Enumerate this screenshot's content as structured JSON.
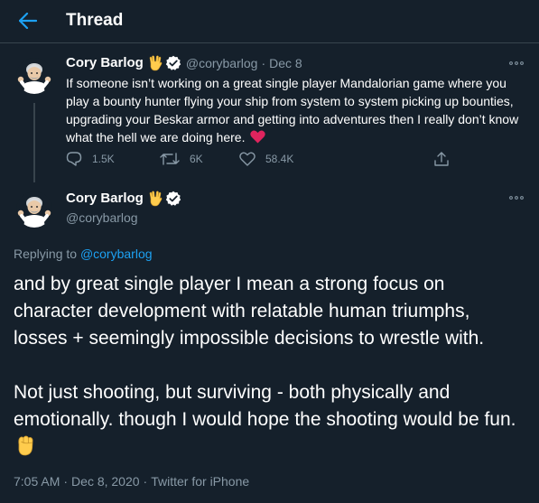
{
  "header": {
    "title": "Thread",
    "back_icon": "arrow-left-icon"
  },
  "colors": {
    "background": "#15202b",
    "accent": "#1da1f2",
    "muted": "#8899a6",
    "divider": "#38444d",
    "heart": "#e0245e"
  },
  "parent_tweet": {
    "display_name": "Cory Barlog",
    "handle": "@corybarlog",
    "separator": "·",
    "date": "Dec 8",
    "badges": [
      "vulcan-salute-emoji",
      "verified-badge-icon"
    ],
    "text": "If someone isn’t working on a great single player Mandalorian game where you play a bounty hunter flying your ship from system to system picking up bounties,  upgrading your Beskar armor and getting into adventures then I really don’t know what the hell we are doing here.",
    "text_emoji": "heart-emoji",
    "actions": {
      "replies": "1.5K",
      "retweets": "6K",
      "likes": "58.4K"
    }
  },
  "focal_tweet": {
    "display_name": "Cory Barlog",
    "handle": "@corybarlog",
    "replying_prefix": "Replying to ",
    "replying_to": "@corybarlog",
    "paragraph1": "and by great single player I mean a strong focus on character development with relatable human triumphs, losses + seemingly impossible decisions to wrestle with.",
    "paragraph2": "Not just shooting, but surviving - both physically and emotionally. though I would hope the shooting would be fun.",
    "paragraph2_emoji": "raised-fist-emoji",
    "time": "7:05 AM",
    "date": "Dec 8, 2020",
    "source": "Twitter for iPhone",
    "separator": "·"
  }
}
